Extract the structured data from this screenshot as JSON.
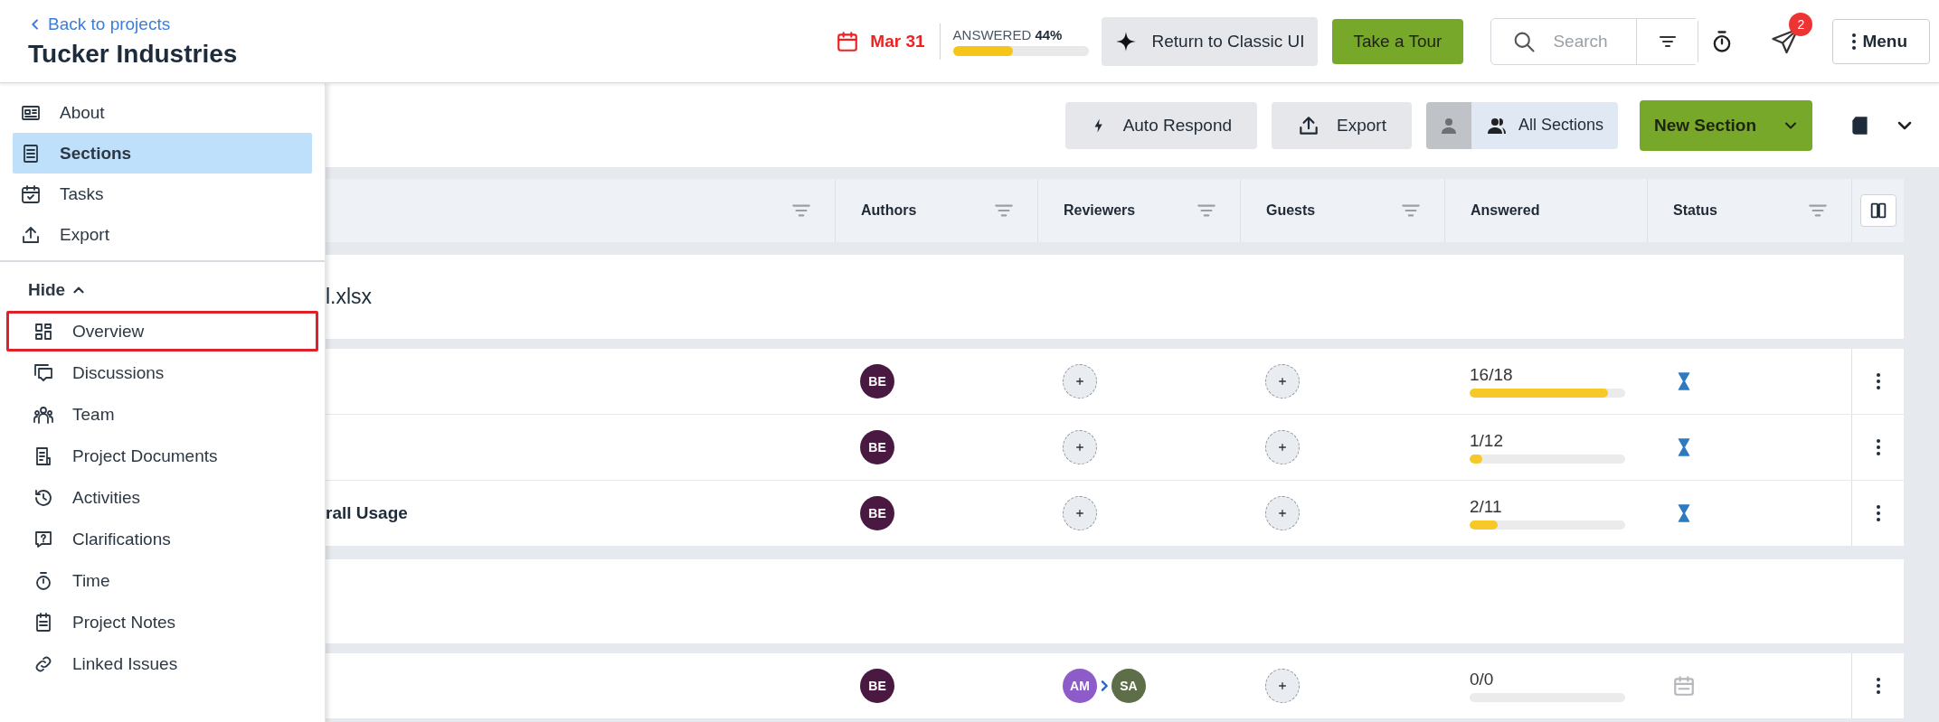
{
  "header": {
    "back_link": "Back to projects",
    "title": "Tucker Industries",
    "due_date": "Mar 31",
    "answered": {
      "label": "ANSWERED",
      "percent": "44%",
      "level": 0.44
    },
    "classic_button": "Return to Classic UI",
    "tour_button": "Take a Tour",
    "search": {
      "placeholder": "Search"
    },
    "notifications": {
      "badge": "2"
    },
    "menu_button": "Menu"
  },
  "sidebar": {
    "primary_items": [
      {
        "label": "About",
        "selected": false
      },
      {
        "label": "Sections",
        "selected": true
      },
      {
        "label": "Tasks",
        "selected": false
      },
      {
        "label": "Export",
        "selected": false
      }
    ],
    "toggle": {
      "label": "Hide",
      "expanded": true
    },
    "secondary_items": [
      {
        "label": "Overview",
        "highlighted": true
      },
      {
        "label": "Discussions",
        "highlighted": false
      },
      {
        "label": "Team",
        "highlighted": false
      },
      {
        "label": "Project Documents",
        "highlighted": false
      },
      {
        "label": "Activities",
        "highlighted": false
      },
      {
        "label": "Clarifications",
        "highlighted": false
      },
      {
        "label": "Time",
        "highlighted": false
      },
      {
        "label": "Project Notes",
        "highlighted": false
      },
      {
        "label": "Linked Issues",
        "highlighted": false
      }
    ]
  },
  "toolbar": {
    "auto_respond": "Auto Respond",
    "export": "Export",
    "sections_filter": "All Sections",
    "new_section": "New Section"
  },
  "table": {
    "columns": [
      {
        "filter": true
      },
      {
        "label": "Authors",
        "filter": true
      },
      {
        "label": "Reviewers",
        "filter": true
      },
      {
        "label": "Guests",
        "filter": true
      },
      {
        "label": "Answered",
        "filter": false
      },
      {
        "label": "Status",
        "filter": true
      }
    ],
    "rows": [
      {
        "kind": "group",
        "title": "l.xlsx"
      },
      {
        "kind": "section",
        "authors": [
          {
            "initials": "BE",
            "color": "#4a1942"
          }
        ],
        "answered": {
          "text": "16/18",
          "level": 0.889
        },
        "status": {
          "kind": "in_progress"
        }
      },
      {
        "kind": "section",
        "authors": [
          {
            "initials": "BE",
            "color": "#4a1942"
          }
        ],
        "answered": {
          "text": "1/12",
          "level": 0.083
        },
        "status": {
          "kind": "in_progress"
        }
      },
      {
        "kind": "section",
        "title": "rall Usage",
        "authors": [
          {
            "initials": "BE",
            "color": "#4a1942"
          }
        ],
        "answered": {
          "text": "2/11",
          "level": 0.182
        },
        "status": {
          "kind": "in_progress"
        }
      },
      {
        "kind": "group"
      },
      {
        "kind": "section",
        "authors": [
          {
            "initials": "BE",
            "color": "#4a1942"
          }
        ],
        "reviewers": [
          {
            "initials": "AM",
            "color": "#8e5cc9"
          },
          {
            "initials": "SA",
            "color": "#5e6e48"
          }
        ],
        "answered": {
          "text": "0/0",
          "level": 0
        },
        "status": {
          "kind": "scheduled"
        }
      }
    ]
  }
}
